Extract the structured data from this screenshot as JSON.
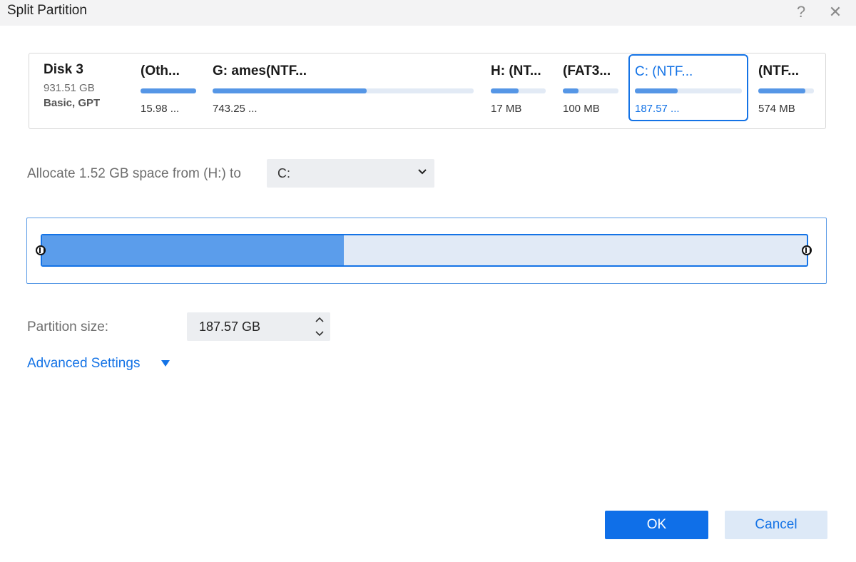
{
  "window": {
    "title": "Split Partition",
    "help_glyph": "?",
    "close_glyph": "✕"
  },
  "disk": {
    "name": "Disk 3",
    "size": "931.51 GB",
    "type": "Basic, GPT",
    "partitions": [
      {
        "label": "(Oth...",
        "size": "15.98 ...",
        "fill": 1.0,
        "selected": false
      },
      {
        "label": "G: ames(NTF...",
        "size": "743.25 ...",
        "fill": 0.59,
        "selected": false
      },
      {
        "label": "H: (NT...",
        "size": "17 MB",
        "fill": 0.5,
        "selected": false
      },
      {
        "label": "(FAT3...",
        "size": "100 MB",
        "fill": 0.28,
        "selected": false
      },
      {
        "label": "C: (NTF...",
        "size": "187.57 ...",
        "fill": 0.4,
        "selected": true
      },
      {
        "label": "(NTF...",
        "size": "574 MB",
        "fill": 0.85,
        "selected": false
      }
    ]
  },
  "allocate": {
    "label": "Allocate 1.52 GB space from (H:) to",
    "target": "C:"
  },
  "resize": {
    "used_fraction": 0.395
  },
  "partition_size": {
    "label": "Partition size:",
    "value": "187.57 GB"
  },
  "advanced": {
    "label": "Advanced Settings"
  },
  "buttons": {
    "ok": "OK",
    "cancel": "Cancel"
  },
  "colors": {
    "accent": "#1473e6",
    "bar_fill": "#5596e6",
    "bar_track": "#e2eaf5"
  }
}
